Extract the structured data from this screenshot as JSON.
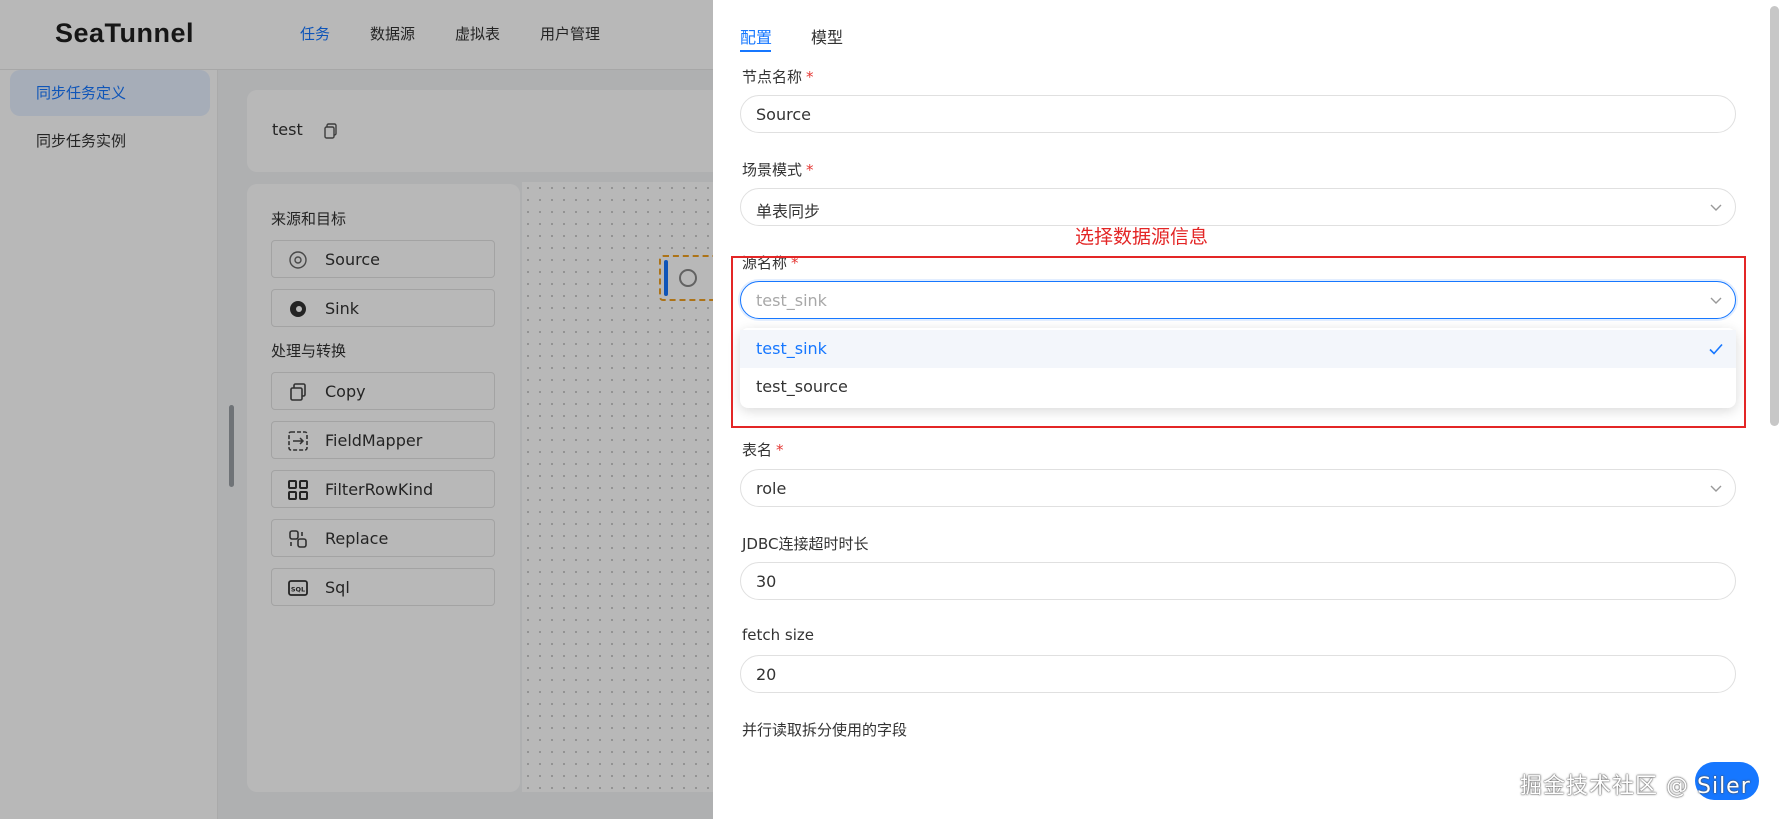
{
  "app": {
    "logo": "SeaTunnel",
    "nav": [
      "任务",
      "数据源",
      "虚拟表",
      "用户管理"
    ],
    "active_nav": "任务"
  },
  "sidebar": {
    "items": [
      {
        "label": "同步任务定义",
        "active": true
      },
      {
        "label": "同步任务实例",
        "active": false
      }
    ]
  },
  "task": {
    "name": "test"
  },
  "palette": {
    "groups": [
      {
        "title": "来源和目标",
        "items": [
          "Source",
          "Sink"
        ]
      },
      {
        "title": "处理与转换",
        "items": [
          "Copy",
          "FieldMapper",
          "FilterRowKind",
          "Replace",
          "Sql"
        ]
      }
    ],
    "icons": [
      "source-icon",
      "sink-icon",
      "copy-icon",
      "field-mapper-icon",
      "filter-row-kind-icon",
      "replace-icon",
      "sql-icon"
    ]
  },
  "drawer": {
    "tabs": [
      {
        "label": "配置",
        "active": true
      },
      {
        "label": "模型",
        "active": false
      }
    ],
    "fields": {
      "node_name": {
        "label": "节点名称",
        "value": "Source",
        "required": true
      },
      "scene_mode": {
        "label": "场景模式",
        "value": "单表同步",
        "required": true
      },
      "source_name": {
        "label": "源名称",
        "placeholder": "test_sink",
        "required": true
      },
      "table_name": {
        "label": "表名",
        "value": "role",
        "required": true
      },
      "jdbc_timeout": {
        "label": "JDBC连接超时时长",
        "value": "30"
      },
      "fetch_size": {
        "label": "fetch size",
        "value": "20"
      },
      "split_field": {
        "label": "并行读取拆分使用的字段"
      }
    },
    "dropdown": {
      "options": [
        {
          "label": "test_sink",
          "selected": true
        },
        {
          "label": "test_source",
          "selected": false
        }
      ]
    },
    "required_mark": "*"
  },
  "annotation": {
    "text": "选择数据源信息",
    "color": "#e32626"
  },
  "watermark": "掘金技术社区 @ Siler",
  "colors": {
    "accent": "#1677ff",
    "required": "#e53935"
  }
}
